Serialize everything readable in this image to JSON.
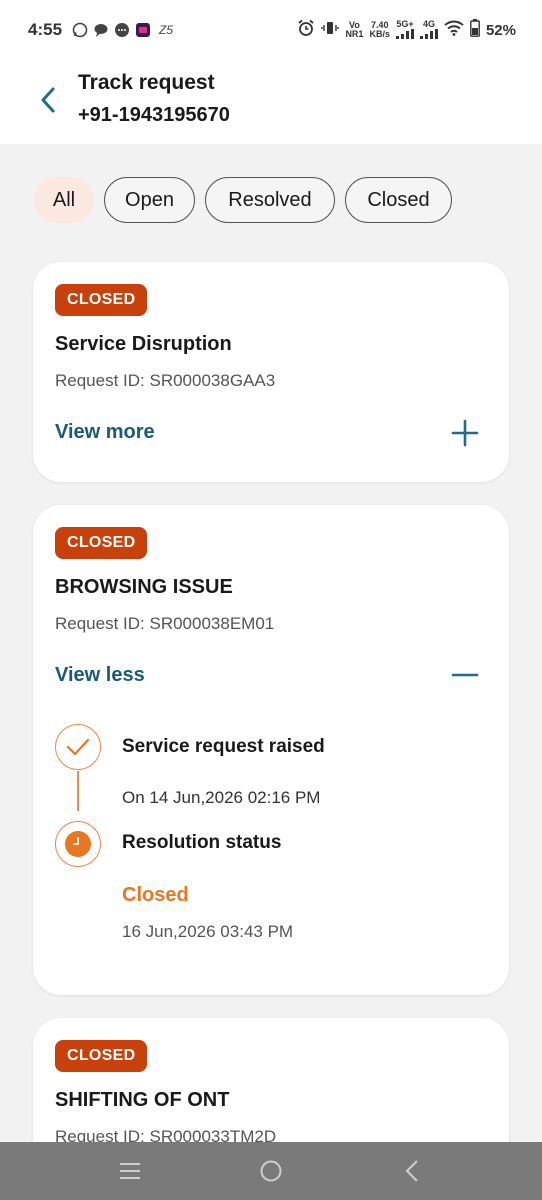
{
  "status_bar": {
    "time": "4:55",
    "network_speed": "7.40",
    "network_speed_unit": "KB/s",
    "vo_label": "Vo",
    "nr_label": "NR1",
    "sig1_label": "5G+",
    "sig2_label": "4G",
    "battery": "52%"
  },
  "header": {
    "title": "Track request",
    "subtitle": "+91-1943195670"
  },
  "filters": [
    {
      "label": "All",
      "active": true
    },
    {
      "label": "Open",
      "active": false
    },
    {
      "label": "Resolved",
      "active": false
    },
    {
      "label": "Closed",
      "active": false
    }
  ],
  "requests": [
    {
      "status": "CLOSED",
      "title": "Service Disruption",
      "request_id": "Request ID: SR000038GAA3",
      "toggle_label": "View more"
    },
    {
      "status": "CLOSED",
      "title": "BROWSING ISSUE",
      "request_id": "Request ID: SR000038EM01",
      "toggle_label": "View less",
      "timeline": {
        "raised_heading": "Service request raised",
        "raised_date": "On 14 Jun,2026 02:16 PM",
        "resolution_heading": "Resolution status",
        "resolution_status": "Closed",
        "resolution_date": "16 Jun,2026 03:43 PM"
      }
    },
    {
      "status": "CLOSED",
      "title": "SHIFTING OF ONT",
      "request_id": "Request ID: SR000033TM2D"
    }
  ],
  "colors": {
    "badge": "#c8400a",
    "link": "#195a78",
    "accent_orange": "#e87722"
  }
}
